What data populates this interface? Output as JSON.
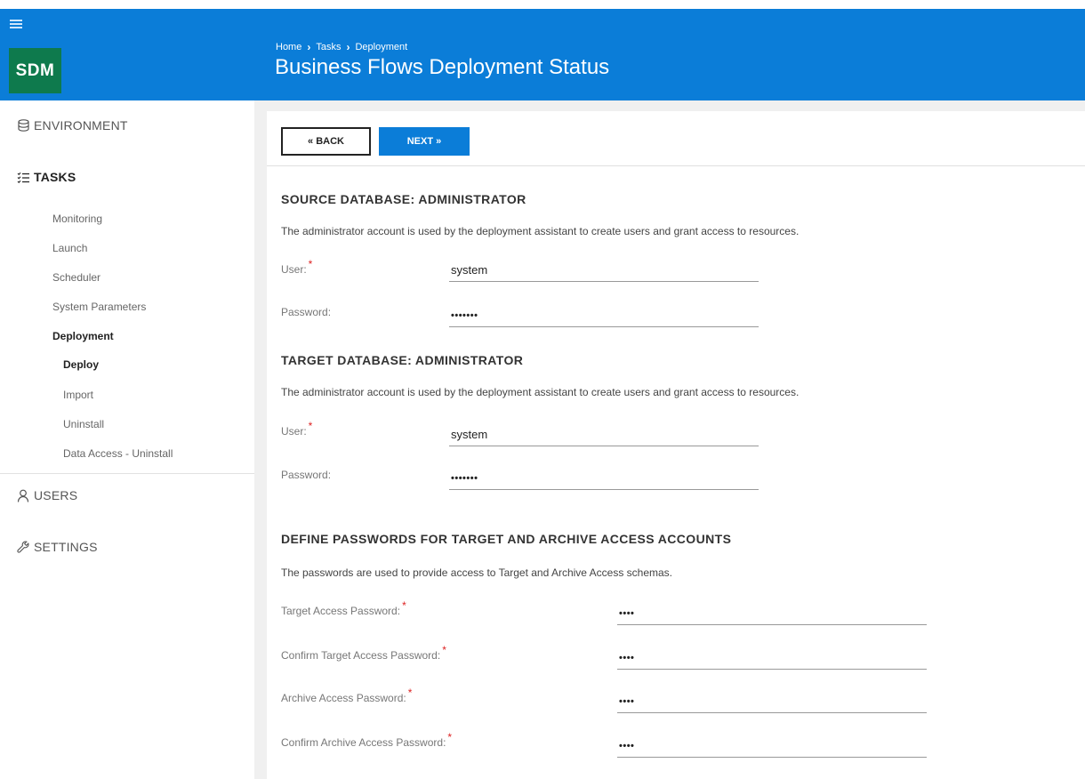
{
  "app": {
    "logo": "SDM"
  },
  "header": {
    "breadcrumb": [
      "Home",
      "Tasks",
      "Deployment"
    ],
    "title": "Business Flows Deployment Status",
    "color": "#0b7dd8"
  },
  "sidebar": {
    "environment": "ENVIRONMENT",
    "tasks": "TASKS",
    "items": [
      {
        "label": "Monitoring"
      },
      {
        "label": "Launch"
      },
      {
        "label": "Scheduler"
      },
      {
        "label": "System Parameters"
      },
      {
        "label": "Deployment"
      },
      {
        "label": "Deploy"
      },
      {
        "label": "Import"
      },
      {
        "label": "Uninstall"
      },
      {
        "label": "Data Access - Uninstall"
      }
    ],
    "users": "USERS",
    "settings": "SETTINGS"
  },
  "toolbar": {
    "back": "« BACK",
    "next": "NEXT »"
  },
  "source": {
    "title": "SOURCE DATABASE: ADMINISTRATOR",
    "desc": "The administrator account is used by the deployment assistant to create users and grant access to resources.",
    "user_label": "User:",
    "user_value": "system",
    "password_label": "Password:",
    "password_value": "•••••••"
  },
  "target": {
    "title": "TARGET DATABASE: ADMINISTRATOR",
    "desc": "The administrator account is used by the deployment assistant to create users and grant access to resources.",
    "user_label": "User:",
    "user_value": "system",
    "password_label": "Password:",
    "password_value": "•••••••"
  },
  "passwords": {
    "title": "DEFINE PASSWORDS FOR TARGET AND ARCHIVE ACCESS ACCOUNTS",
    "desc": "The passwords are used to provide access to Target and Archive Access schemas.",
    "target_label": "Target Access Password:",
    "target_value": "••••",
    "confirm_target_label": "Confirm Target Access Password:",
    "confirm_target_value": "••••",
    "archive_label": "Archive Access Password:",
    "archive_value": "••••",
    "confirm_archive_label": "Confirm Archive Access Password:",
    "confirm_archive_value": "••••"
  },
  "required_mark": "*"
}
